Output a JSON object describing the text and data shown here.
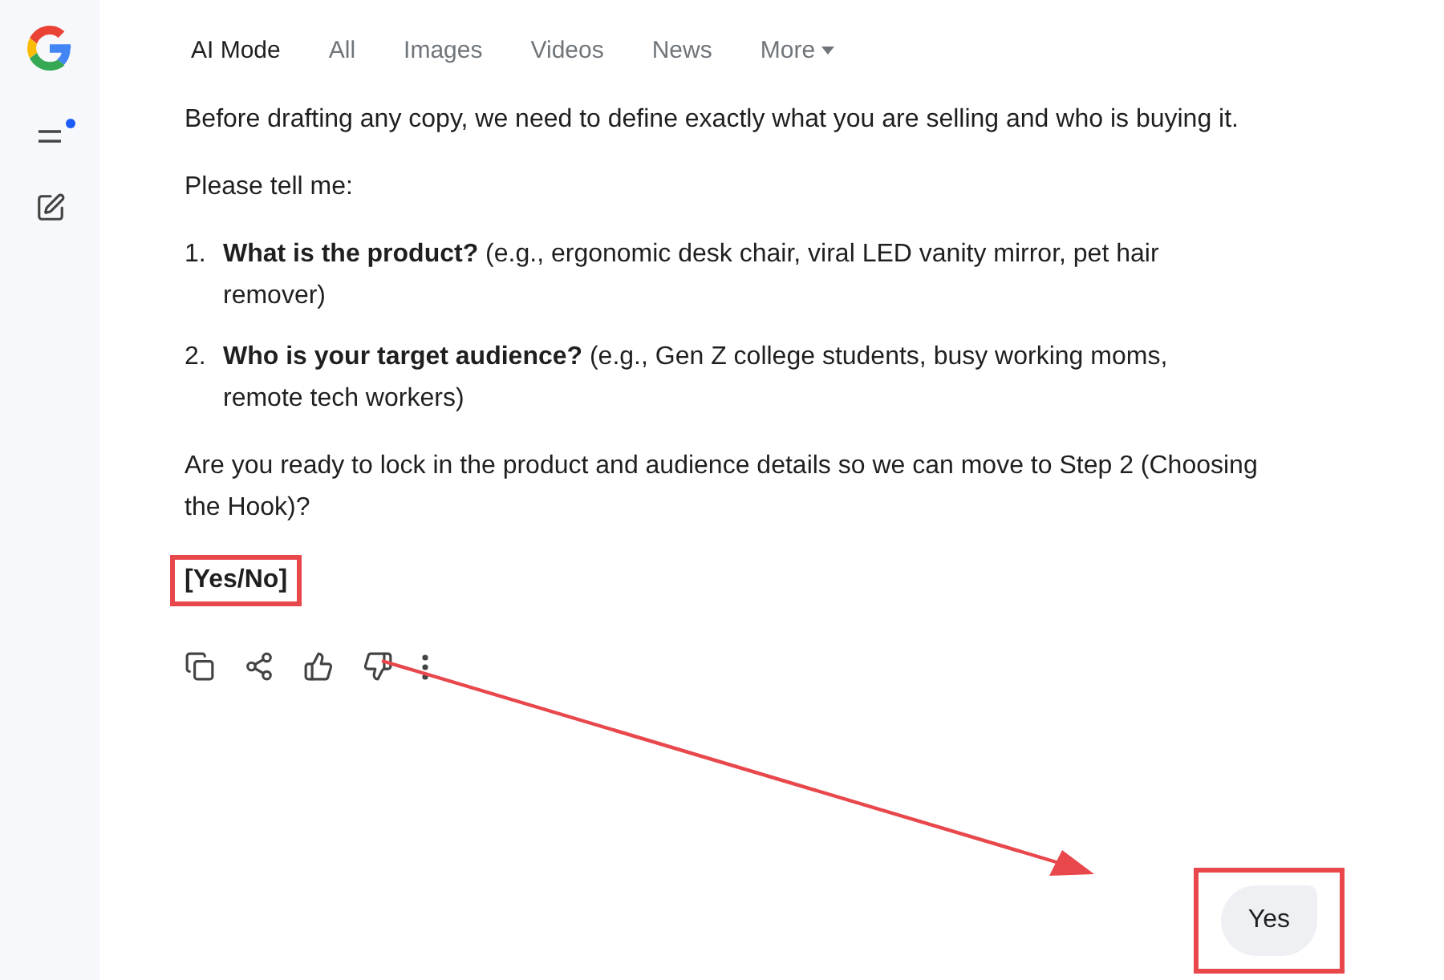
{
  "tabs": [
    {
      "label": "AI Mode",
      "selected": true
    },
    {
      "label": "All",
      "selected": false
    },
    {
      "label": "Images",
      "selected": false
    },
    {
      "label": "Videos",
      "selected": false
    },
    {
      "label": "News",
      "selected": false
    },
    {
      "label": "More",
      "selected": false,
      "dropdown": true
    }
  ],
  "sidebar": {
    "menu_notification": true
  },
  "answer": {
    "intro": "Before drafting any copy, we need to define exactly what you are selling and who is buying it.",
    "prompt": "Please tell me:",
    "list": [
      {
        "number": "1.",
        "text": "**What is the product?** (e.g., ergonomic desk chair, viral LED vanity mirror, pet hair remover)"
      },
      {
        "number": "2.",
        "text": "**Who is your target audience?** (e.g., Gen Z college students, busy working moms, remote tech workers)"
      }
    ],
    "question": "Are you ready to lock in the product and audience details so we can move to Step 2 (Choosing the Hook)?",
    "options": "[Yes/No]"
  },
  "reply": "Yes"
}
